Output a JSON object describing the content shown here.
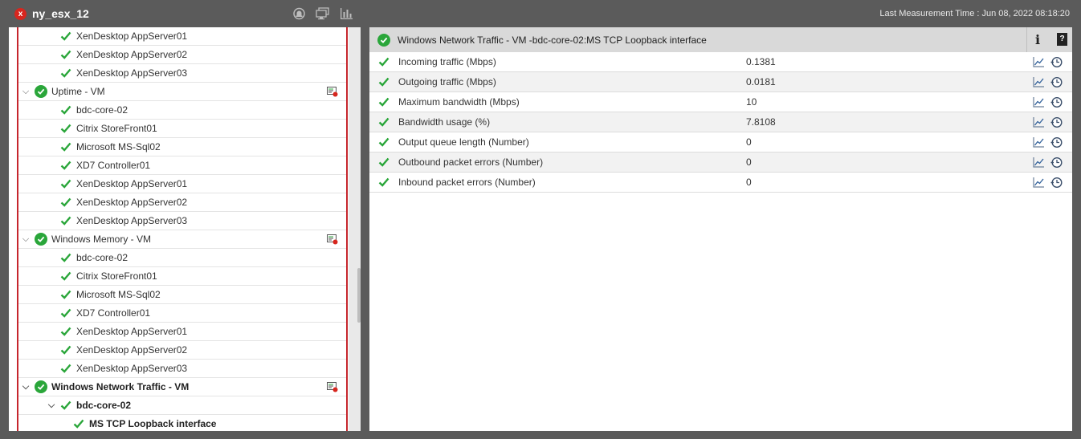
{
  "window": {
    "title": "ny_esx_12",
    "status": "critical",
    "last_measurement": "Last Measurement Time : Jun 08, 2022 08:18:20"
  },
  "toolbar_icons": [
    "alarm-icon",
    "monitor-icon",
    "bar-chart-icon"
  ],
  "colors": {
    "ok": "#2aa63a",
    "critical": "#d7261e",
    "accent_border": "#c6262d",
    "header_bg": "#d9d9d9"
  },
  "tree": [
    {
      "label": "XenDesktop AppServer01",
      "level": 2
    },
    {
      "label": "XenDesktop AppServer02",
      "level": 2
    },
    {
      "label": "XenDesktop AppServer03",
      "level": 2
    },
    {
      "label": "Uptime - VM",
      "level": 1,
      "group": true
    },
    {
      "label": "bdc-core-02",
      "level": 2
    },
    {
      "label": "Citrix StoreFront01",
      "level": 2
    },
    {
      "label": "Microsoft MS-Sql02",
      "level": 2
    },
    {
      "label": "XD7 Controller01",
      "level": 2
    },
    {
      "label": "XenDesktop AppServer01",
      "level": 2
    },
    {
      "label": "XenDesktop AppServer02",
      "level": 2
    },
    {
      "label": "XenDesktop AppServer03",
      "level": 2
    },
    {
      "label": "Windows Memory - VM",
      "level": 1,
      "group": true
    },
    {
      "label": "bdc-core-02",
      "level": 2
    },
    {
      "label": "Citrix StoreFront01",
      "level": 2
    },
    {
      "label": "Microsoft MS-Sql02",
      "level": 2
    },
    {
      "label": "XD7 Controller01",
      "level": 2
    },
    {
      "label": "XenDesktop AppServer01",
      "level": 2
    },
    {
      "label": "XenDesktop AppServer02",
      "level": 2
    },
    {
      "label": "XenDesktop AppServer03",
      "level": 2
    },
    {
      "label": "Windows Network Traffic - VM",
      "level": 1,
      "group": true,
      "bold": true
    },
    {
      "label": "bdc-core-02",
      "level": 2,
      "expandable": true,
      "bold": true
    },
    {
      "label": "MS TCP Loopback interface",
      "level": 3,
      "bold": true
    }
  ],
  "detail": {
    "title": "Windows Network Traffic - VM -bdc-core-02:MS TCP Loopback interface",
    "info_label": "i",
    "help_label": "?",
    "measures": [
      {
        "name": "Incoming traffic (Mbps)",
        "value": "0.1381"
      },
      {
        "name": "Outgoing traffic (Mbps)",
        "value": "0.0181"
      },
      {
        "name": "Maximum bandwidth (Mbps)",
        "value": "10"
      },
      {
        "name": "Bandwidth usage (%)",
        "value": "7.8108"
      },
      {
        "name": "Output queue length (Number)",
        "value": "0"
      },
      {
        "name": "Outbound packet errors (Number)",
        "value": "0"
      },
      {
        "name": "Inbound packet errors (Number)",
        "value": "0"
      }
    ]
  }
}
